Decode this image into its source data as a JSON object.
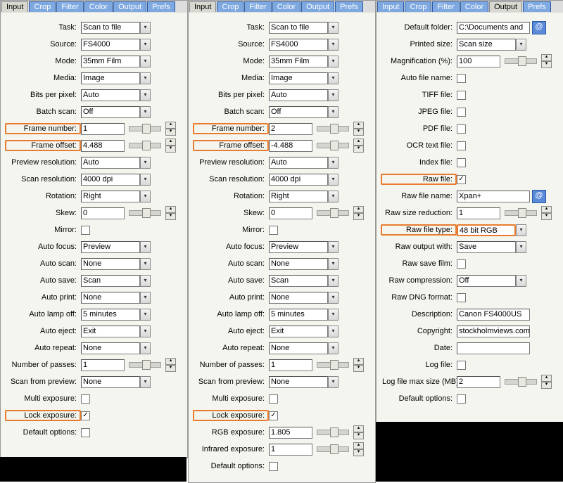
{
  "tabs": [
    "Input",
    "Crop",
    "Filter",
    "Color",
    "Output",
    "Prefs"
  ],
  "panes": [
    {
      "active": 0,
      "rows": [
        {
          "lab": "Task:",
          "type": "sel",
          "v": "Scan to file"
        },
        {
          "lab": "Source:",
          "type": "sel",
          "v": "FS4000"
        },
        {
          "lab": "Mode:",
          "type": "sel",
          "v": "35mm Film"
        },
        {
          "lab": "Media:",
          "type": "sel",
          "v": "Image"
        },
        {
          "lab": "Bits per pixel:",
          "type": "sel",
          "v": "Auto"
        },
        {
          "lab": "Batch scan:",
          "type": "sel",
          "v": "Off"
        },
        {
          "lab": "Frame number:",
          "type": "numsl",
          "v": "1",
          "hl": true
        },
        {
          "lab": "Frame offset:",
          "type": "numsl",
          "v": "4.488",
          "hl": true
        },
        {
          "lab": "Preview resolution:",
          "type": "sel",
          "v": "Auto"
        },
        {
          "lab": "Scan resolution:",
          "type": "sel",
          "v": "4000 dpi"
        },
        {
          "lab": "Rotation:",
          "type": "sel",
          "v": "Right"
        },
        {
          "lab": "Skew:",
          "type": "numsl",
          "v": "0"
        },
        {
          "lab": "Mirror:",
          "type": "chk",
          "c": false
        },
        {
          "lab": "Auto focus:",
          "type": "sel",
          "v": "Preview"
        },
        {
          "lab": "Auto scan:",
          "type": "sel",
          "v": "None"
        },
        {
          "lab": "Auto save:",
          "type": "sel",
          "v": "Scan"
        },
        {
          "lab": "Auto print:",
          "type": "sel",
          "v": "None"
        },
        {
          "lab": "Auto lamp off:",
          "type": "sel",
          "v": "5 minutes"
        },
        {
          "lab": "Auto eject:",
          "type": "sel",
          "v": "Exit"
        },
        {
          "lab": "Auto repeat:",
          "type": "sel",
          "v": "None"
        },
        {
          "lab": "Number of passes:",
          "type": "numsl",
          "v": "1"
        },
        {
          "lab": "Scan from preview:",
          "type": "sel",
          "v": "None"
        },
        {
          "lab": "Multi exposure:",
          "type": "chk",
          "c": false
        },
        {
          "lab": "Lock exposure:",
          "type": "chk",
          "c": true,
          "hl": true
        },
        {
          "lab": "Default options:",
          "type": "chk",
          "c": false
        }
      ]
    },
    {
      "active": 0,
      "rows": [
        {
          "lab": "Task:",
          "type": "sel",
          "v": "Scan to file"
        },
        {
          "lab": "Source:",
          "type": "sel",
          "v": "FS4000"
        },
        {
          "lab": "Mode:",
          "type": "sel",
          "v": "35mm Film"
        },
        {
          "lab": "Media:",
          "type": "sel",
          "v": "Image"
        },
        {
          "lab": "Bits per pixel:",
          "type": "sel",
          "v": "Auto"
        },
        {
          "lab": "Batch scan:",
          "type": "sel",
          "v": "Off"
        },
        {
          "lab": "Frame number:",
          "type": "numsl",
          "v": "2",
          "hl": true
        },
        {
          "lab": "Frame offset:",
          "type": "numsl",
          "v": "-4.488",
          "hl": true
        },
        {
          "lab": "Preview resolution:",
          "type": "sel",
          "v": "Auto"
        },
        {
          "lab": "Scan resolution:",
          "type": "sel",
          "v": "4000 dpi"
        },
        {
          "lab": "Rotation:",
          "type": "sel",
          "v": "Right"
        },
        {
          "lab": "Skew:",
          "type": "numsl",
          "v": "0"
        },
        {
          "lab": "Mirror:",
          "type": "chk",
          "c": false
        },
        {
          "lab": "Auto focus:",
          "type": "sel",
          "v": "Preview"
        },
        {
          "lab": "Auto scan:",
          "type": "sel",
          "v": "None"
        },
        {
          "lab": "Auto save:",
          "type": "sel",
          "v": "Scan"
        },
        {
          "lab": "Auto print:",
          "type": "sel",
          "v": "None"
        },
        {
          "lab": "Auto lamp off:",
          "type": "sel",
          "v": "5 minutes"
        },
        {
          "lab": "Auto eject:",
          "type": "sel",
          "v": "Exit"
        },
        {
          "lab": "Auto repeat:",
          "type": "sel",
          "v": "None"
        },
        {
          "lab": "Number of passes:",
          "type": "numsl",
          "v": "1"
        },
        {
          "lab": "Scan from preview:",
          "type": "sel",
          "v": "None"
        },
        {
          "lab": "Multi exposure:",
          "type": "chk",
          "c": false
        },
        {
          "lab": "Lock exposure:",
          "type": "chk",
          "c": true,
          "hl": true
        },
        {
          "lab": "RGB exposure:",
          "type": "numsl",
          "v": "1.805"
        },
        {
          "lab": "Infrared exposure:",
          "type": "numsl",
          "v": "1"
        },
        {
          "lab": "Default options:",
          "type": "chk",
          "c": false
        }
      ]
    },
    {
      "active": 4,
      "rows": [
        {
          "lab": "Default folder:",
          "type": "txtat",
          "v": "C:\\Documents and"
        },
        {
          "lab": "Printed size:",
          "type": "sel",
          "v": "Scan size"
        },
        {
          "lab": "Magnification (%):",
          "type": "numsl",
          "v": "100"
        },
        {
          "lab": "Auto file name:",
          "type": "chk",
          "c": false
        },
        {
          "lab": "TIFF file:",
          "type": "chk",
          "c": false
        },
        {
          "lab": "JPEG file:",
          "type": "chk",
          "c": false
        },
        {
          "lab": "PDF file:",
          "type": "chk",
          "c": false
        },
        {
          "lab": "OCR text file:",
          "type": "chk",
          "c": false
        },
        {
          "lab": "Index file:",
          "type": "chk",
          "c": false
        },
        {
          "lab": "Raw file:",
          "type": "chk",
          "c": true,
          "hl": true
        },
        {
          "lab": "Raw file name:",
          "type": "txtat",
          "v": "Xpan+"
        },
        {
          "lab": "Raw size reduction:",
          "type": "numsl",
          "v": "1"
        },
        {
          "lab": "Raw file type:",
          "type": "sel",
          "v": "48 bit RGB",
          "hl": true
        },
        {
          "lab": "Raw output with:",
          "type": "sel",
          "v": "Save"
        },
        {
          "lab": "Raw save film:",
          "type": "chk",
          "c": false
        },
        {
          "lab": "Raw compression:",
          "type": "sel",
          "v": "Off"
        },
        {
          "lab": "Raw DNG format:",
          "type": "chk",
          "c": false
        },
        {
          "lab": "Description:",
          "type": "txt",
          "v": "Canon FS4000US"
        },
        {
          "lab": "Copyright:",
          "type": "txt",
          "v": "stockholmviews.com"
        },
        {
          "lab": "Date:",
          "type": "txt",
          "v": ""
        },
        {
          "lab": "Log file:",
          "type": "chk",
          "c": false
        },
        {
          "lab": "Log file max size (MB):",
          "type": "numsl",
          "v": "2"
        },
        {
          "lab": "Default options:",
          "type": "chk",
          "c": false
        }
      ]
    }
  ]
}
